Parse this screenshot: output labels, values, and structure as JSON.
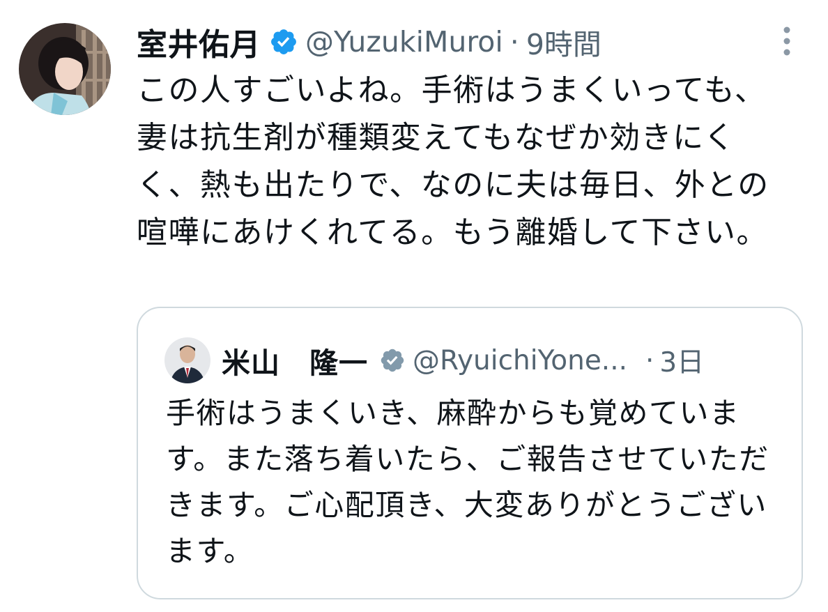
{
  "tweet": {
    "author_name": "室井佑月",
    "handle": "@YuzukiMuroi",
    "separator": "·",
    "time": "9時間",
    "text": "この人すごいよね。手術はうまくいっても、妻は抗生剤が種類変えてもなぜか効きにくく、熱も出たりで、なのに夫は毎日、外との喧嘩にあけくれてる。もう離婚して下さい。",
    "avatar_icon": "profile-photo",
    "verified_icon": "verified-badge-icon",
    "more_icon": "more-vertical-icon"
  },
  "quoted_tweet": {
    "author_name": "米山　隆一",
    "handle": "@RyuichiYone...",
    "separator": "·",
    "time": "3日",
    "text": "手術はうまくいき、麻酔からも覚めています。また落ち着いたら、ご報告させていただきます。ご心配頂き、大変ありがとうございます。",
    "avatar_icon": "profile-photo",
    "verified_icon": "verified-badge-gray-icon"
  },
  "colors": {
    "text_primary": "#0f1419",
    "text_secondary": "#536471",
    "verified_blue": "#1d9bf0",
    "verified_gray": "#829aab",
    "border": "#cfd9de"
  }
}
